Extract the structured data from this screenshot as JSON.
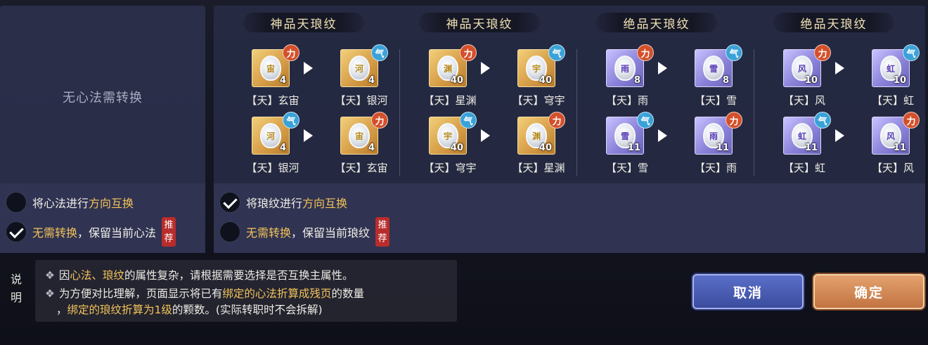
{
  "left_panel": {
    "empty_text": "无心法需转换",
    "option_swap": {
      "prefix": "将心法进行",
      "highlight": "方向互换",
      "checked": false
    },
    "option_keep": {
      "highlight": "无需转换",
      "suffix": "，保留当前心法",
      "badge": "推荐",
      "checked": true
    }
  },
  "right_panel": {
    "columns": [
      {
        "title": "神品天琅纹",
        "rows": [
          {
            "from": {
              "name": "【天】玄宙",
              "level": "4",
              "badge": "力",
              "tier": "gold",
              "glyph": "宙"
            },
            "to": {
              "name": "【天】银河",
              "level": "4",
              "badge": "气",
              "tier": "gold",
              "glyph": "河"
            }
          },
          {
            "from": {
              "name": "【天】银河",
              "level": "4",
              "badge": "气",
              "tier": "gold",
              "glyph": "河"
            },
            "to": {
              "name": "【天】玄宙",
              "level": "4",
              "badge": "力",
              "tier": "gold",
              "glyph": "宙"
            }
          }
        ]
      },
      {
        "title": "神品天琅纹",
        "rows": [
          {
            "from": {
              "name": "【天】星渊",
              "level": "40",
              "badge": "力",
              "tier": "gold",
              "glyph": "渊"
            },
            "to": {
              "name": "【天】穹宇",
              "level": "40",
              "badge": "气",
              "tier": "gold",
              "glyph": "宇"
            }
          },
          {
            "from": {
              "name": "【天】穹宇",
              "level": "40",
              "badge": "气",
              "tier": "gold",
              "glyph": "宇"
            },
            "to": {
              "name": "【天】星渊",
              "level": "40",
              "badge": "力",
              "tier": "gold",
              "glyph": "渊"
            }
          }
        ]
      },
      {
        "title": "绝品天琅纹",
        "rows": [
          {
            "from": {
              "name": "【天】雨",
              "level": "8",
              "badge": "力",
              "tier": "purple",
              "glyph": "雨"
            },
            "to": {
              "name": "【天】雪",
              "level": "8",
              "badge": "气",
              "tier": "purple",
              "glyph": "雪"
            }
          },
          {
            "from": {
              "name": "【天】雪",
              "level": "11",
              "badge": "气",
              "tier": "purple",
              "glyph": "雪"
            },
            "to": {
              "name": "【天】雨",
              "level": "11",
              "badge": "力",
              "tier": "purple",
              "glyph": "雨"
            }
          }
        ]
      },
      {
        "title": "绝品天琅纹",
        "rows": [
          {
            "from": {
              "name": "【天】风",
              "level": "10",
              "badge": "力",
              "tier": "purple",
              "glyph": "风"
            },
            "to": {
              "name": "【天】虹",
              "level": "10",
              "badge": "气",
              "tier": "purple",
              "glyph": "虹"
            }
          },
          {
            "from": {
              "name": "【天】虹",
              "level": "11",
              "badge": "气",
              "tier": "purple",
              "glyph": "虹"
            },
            "to": {
              "name": "【天】风",
              "level": "11",
              "badge": "力",
              "tier": "purple",
              "glyph": "风"
            }
          }
        ]
      }
    ],
    "option_swap": {
      "prefix": "将琅纹进行",
      "highlight": "方向互换",
      "checked": true
    },
    "option_keep": {
      "highlight": "无需转换",
      "suffix": "，保留当前琅纹",
      "badge": "推荐",
      "checked": false
    }
  },
  "note": {
    "label": "说明",
    "line1": {
      "a": "因",
      "hl": "心法、琅纹",
      "b": "的属性复杂，请根据需要选择是否互换主属性。"
    },
    "line2": {
      "a": "为方便对比理解，页面显示将已有",
      "hl": "绑定的心法折算成残页",
      "b": "的数量"
    },
    "line3": {
      "a": "，",
      "hl": "绑定的琅纹折算为1级",
      "b": "的颗数。(实际转职时不会拆解)"
    }
  },
  "buttons": {
    "cancel": "取消",
    "confirm": "确定"
  },
  "colors": {
    "highlight": "#f2c35a",
    "badge_li": "#d4502a",
    "badge_qi": "#3aa2d8",
    "recommend": "#b82c2c"
  }
}
